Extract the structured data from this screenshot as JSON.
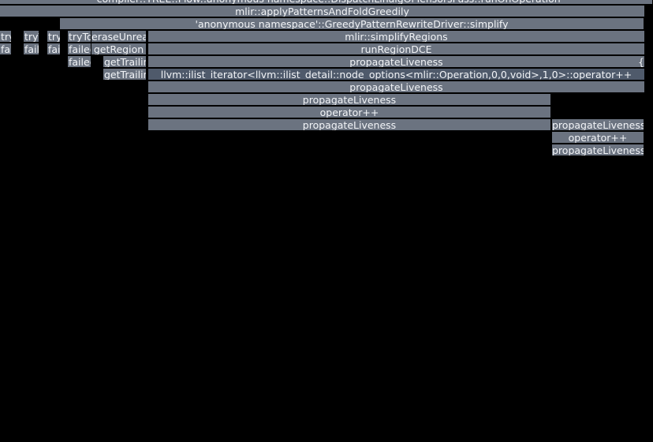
{
  "chart_data": {
    "type": "flamegraph",
    "title": "",
    "frames": [
      {
        "label": "_compiler::TREE::Flow::anonymous namespace::DispatchLinalgOrTensorsPass::runOnOperation",
        "depth": 0,
        "start": 0.0,
        "width": 1.0
      },
      {
        "label": "mlir::applyPatternsAndFoldGreedily",
        "depth": 1,
        "start": 0.0,
        "width": 0.988
      },
      {
        "label": "'anonymous namespace'::GreedyPatternRewriteDriver::simplify",
        "depth": 2,
        "start": 0.092,
        "width": 0.895
      },
      {
        "label": "mlir::simplifyRegions",
        "depth": 3,
        "start": 0.227,
        "width": 0.761
      },
      {
        "label": "runRegionDCE",
        "depth": 4,
        "start": 0.227,
        "width": 0.761
      },
      {
        "label": "propagateLiveness",
        "depth": 5,
        "start": 0.227,
        "width": 0.761
      },
      {
        "label": "llvm::ilist_iterator<llvm::ilist_detail::node_options<mlir::Operation,0,0,void>,1,0>::operator++",
        "depth": 6,
        "start": 0.227,
        "width": 0.761,
        "hl": true
      },
      {
        "label": "propagateLiveness",
        "depth": 7,
        "start": 0.227,
        "width": 0.761
      },
      {
        "label": "propagateLiveness",
        "depth": 8,
        "start": 0.227,
        "width": 0.617
      },
      {
        "label": "operator++",
        "depth": 9,
        "start": 0.227,
        "width": 0.617
      },
      {
        "label": "propagateLiveness",
        "depth": 10,
        "start": 0.227,
        "width": 0.617
      },
      {
        "label": "propagateLiveness",
        "depth": 10,
        "start": 0.845,
        "width": 0.141
      },
      {
        "label": "operator++",
        "depth": 11,
        "start": 0.845,
        "width": 0.141
      },
      {
        "label": "propagateLiveness",
        "depth": 12,
        "start": 0.845,
        "width": 0.141
      },
      {
        "label": "eraseUnreachableBlocks",
        "depth": 3,
        "start": 0.14,
        "width": 0.085
      },
      {
        "label": "getRegion",
        "depth": 4,
        "start": 0.14,
        "width": 0.085
      },
      {
        "label": "getTrailingObjects",
        "depth": 5,
        "start": 0.158,
        "width": 0.067
      },
      {
        "label": "getTrailingObjects",
        "depth": 6,
        "start": 0.158,
        "width": 0.067
      },
      {
        "label": "tryToFold",
        "depth": 3,
        "start": 0.0,
        "width": 0.018
      },
      {
        "label": "failed",
        "depth": 4,
        "start": 0.0,
        "width": 0.018
      },
      {
        "label": "tryToFold",
        "depth": 3,
        "start": 0.036,
        "width": 0.024
      },
      {
        "label": "failed",
        "depth": 4,
        "start": 0.036,
        "width": 0.024
      },
      {
        "label": "tryToFold",
        "depth": 3,
        "start": 0.072,
        "width": 0.02
      },
      {
        "label": "failed",
        "depth": 4,
        "start": 0.072,
        "width": 0.02
      },
      {
        "label": "tryToFold",
        "depth": 3,
        "start": 0.104,
        "width": 0.036
      },
      {
        "label": "failed",
        "depth": 4,
        "start": 0.104,
        "width": 0.036
      },
      {
        "label": "failed",
        "depth": 5,
        "start": 0.104,
        "width": 0.036
      },
      {
        "label": "{(",
        "depth": 5,
        "start": 0.976,
        "width": 0.012
      }
    ]
  }
}
